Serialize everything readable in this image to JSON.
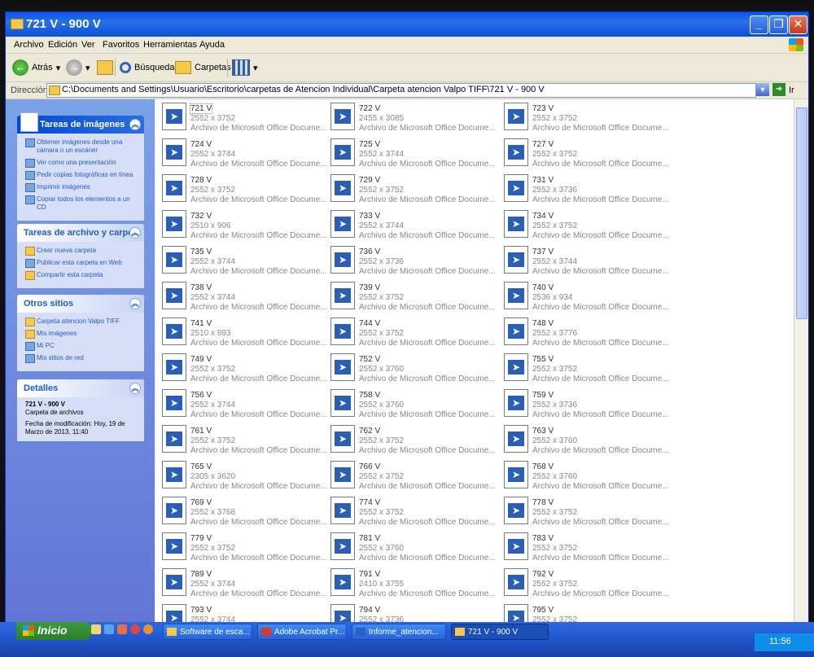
{
  "window": {
    "title": "721 V - 900 V"
  },
  "menu": [
    "Archivo",
    "Edición",
    "Ver",
    "Favoritos",
    "Herramientas",
    "Ayuda"
  ],
  "toolbar": {
    "back": "Atrás",
    "search": "Búsqueda",
    "folders": "Carpetas"
  },
  "address": {
    "label": "Dirección",
    "path": "C:\\Documents and Settings\\Usuario\\Escritorio\\carpetas de Atencion Individual\\Carpeta atencion Valpo TIFF\\721 V - 900 V",
    "go": "Ir"
  },
  "panels": {
    "image_tasks": {
      "title": "Tareas de imágenes",
      "items": [
        "Obtener imágenes desde una cámara o un escáner",
        "Ver como una presentación",
        "Pedir copias fotográficas en línea",
        "Imprimir imágenes",
        "Copiar todos los elementos a un CD"
      ]
    },
    "file_tasks": {
      "title": "Tareas de archivo y carpeta",
      "items": [
        "Crear nueva carpeta",
        "Publicar esta carpeta en Web",
        "Compartir esta carpeta"
      ]
    },
    "other_places": {
      "title": "Otros sitios",
      "items": [
        "Carpeta atencion Valpo TIFF",
        "Mis imágenes",
        "Mi PC",
        "Mis sitios de red"
      ]
    },
    "details": {
      "title": "Detalles",
      "name": "721 V - 900 V",
      "type": "Carpeta de archivos",
      "modified": "Fecha de modificación: Hoy, 19 de Marzo de 2013, 11:40"
    }
  },
  "file_type": "Archivo de Microsoft Office Docume...",
  "files": [
    {
      "name": "721 V",
      "dim": "2552 x 3752"
    },
    {
      "name": "722 V",
      "dim": "2455 x 3085"
    },
    {
      "name": "723 V",
      "dim": "2552 x 3752"
    },
    {
      "name": "724 V",
      "dim": "2552 x 3744"
    },
    {
      "name": "725 V",
      "dim": "2552 x 3744"
    },
    {
      "name": "727 V",
      "dim": "2552 x 3752"
    },
    {
      "name": "728 V",
      "dim": "2552 x 3752"
    },
    {
      "name": "729 V",
      "dim": "2552 x 3752"
    },
    {
      "name": "731 V",
      "dim": "2552 x 3736"
    },
    {
      "name": "732 V",
      "dim": "2510 x 906"
    },
    {
      "name": "733 V",
      "dim": "2552 x 3744"
    },
    {
      "name": "734 V",
      "dim": "2552 x 3752"
    },
    {
      "name": "735 V",
      "dim": "2552 x 3744"
    },
    {
      "name": "736 V",
      "dim": "2552 x 3736"
    },
    {
      "name": "737 V",
      "dim": "2552 x 3744"
    },
    {
      "name": "738 V",
      "dim": "2552 x 3744"
    },
    {
      "name": "739 V",
      "dim": "2552 x 3752"
    },
    {
      "name": "740 V",
      "dim": "2536 x 934"
    },
    {
      "name": "741 V",
      "dim": "2510 x 893"
    },
    {
      "name": "744 V",
      "dim": "2552 x 3752"
    },
    {
      "name": "748 V",
      "dim": "2552 x 3776"
    },
    {
      "name": "749 V",
      "dim": "2552 x 3752"
    },
    {
      "name": "752 V",
      "dim": "2552 x 3760"
    },
    {
      "name": "755 V",
      "dim": "2552 x 3752"
    },
    {
      "name": "756 V",
      "dim": "2552 x 3744"
    },
    {
      "name": "758 V",
      "dim": "2552 x 3760"
    },
    {
      "name": "759 V",
      "dim": "2552 x 3736"
    },
    {
      "name": "761 V",
      "dim": "2552 x 3752"
    },
    {
      "name": "762 V",
      "dim": "2552 x 3752"
    },
    {
      "name": "763 V",
      "dim": "2552 x 3760"
    },
    {
      "name": "765 V",
      "dim": "2305 x 3620"
    },
    {
      "name": "766 V",
      "dim": "2552 x 3752"
    },
    {
      "name": "768 V",
      "dim": "2552 x 3760"
    },
    {
      "name": "769 V",
      "dim": "2552 x 3768"
    },
    {
      "name": "774 V",
      "dim": "2552 x 3752"
    },
    {
      "name": "778 V",
      "dim": "2552 x 3752"
    },
    {
      "name": "779 V",
      "dim": "2552 x 3752"
    },
    {
      "name": "781 V",
      "dim": "2552 x 3760"
    },
    {
      "name": "783 V",
      "dim": "2552 x 3752"
    },
    {
      "name": "789 V",
      "dim": "2552 x 3744"
    },
    {
      "name": "791 V",
      "dim": "2410 x 3755"
    },
    {
      "name": "792 V",
      "dim": "2552 x 3752"
    },
    {
      "name": "793 V",
      "dim": "2552 x 3744"
    },
    {
      "name": "794 V",
      "dim": "2552 x 3736"
    },
    {
      "name": "795 V",
      "dim": "2552 x 3752"
    }
  ],
  "taskbar": {
    "start": "Inicio",
    "buttons": [
      "Software de esca...",
      "Adobe Acrobat Pr...",
      "Informe_atencion...",
      "721 V - 900 V"
    ],
    "clock": "11:56"
  }
}
